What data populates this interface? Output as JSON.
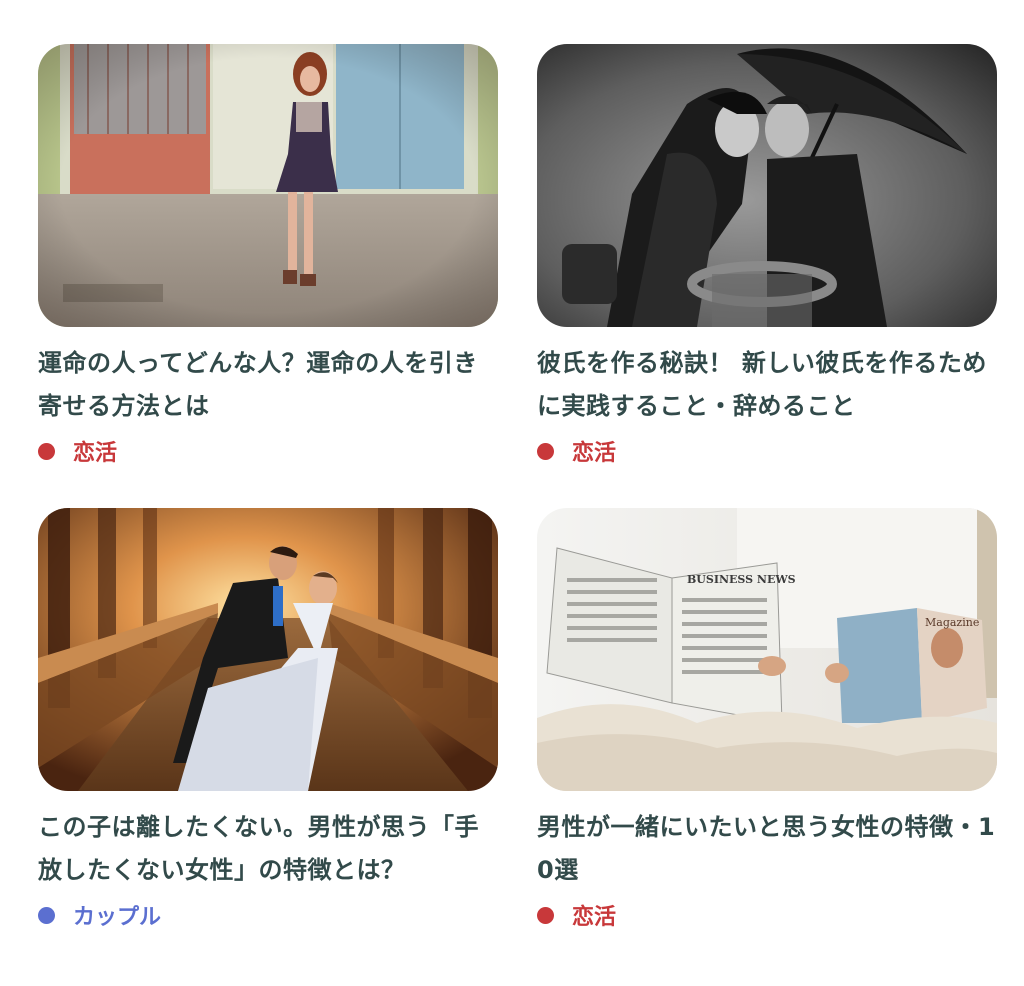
{
  "articles": [
    {
      "title": "運命の人ってどんな人？運命の人を引き寄せる方法とは",
      "category": "恋活",
      "category_color": "#c8383a",
      "image": "woman-by-colored-doors-photo"
    },
    {
      "title": "彼氏を作る秘訣！ 新しい彼氏を作るために実践すること・辞めること",
      "category": "恋活",
      "category_color": "#c8383a",
      "image": "couple-kissing-under-umbrella-photo"
    },
    {
      "title": "この子は離したくない。男性が思う「手放したくない女性」の特徴とは？",
      "category": "カップル",
      "category_color": "#5b6fd0",
      "image": "bride-and-groom-on-bridge-photo"
    },
    {
      "title": "男性が一緒にいたいと思う女性の特徴・10選",
      "category": "恋活",
      "category_color": "#c8383a",
      "image": "couple-reading-newspaper-in-bed-photo",
      "newspaper_masthead": "BUSINESS NEWS",
      "magazine_masthead": "Magazine"
    }
  ]
}
